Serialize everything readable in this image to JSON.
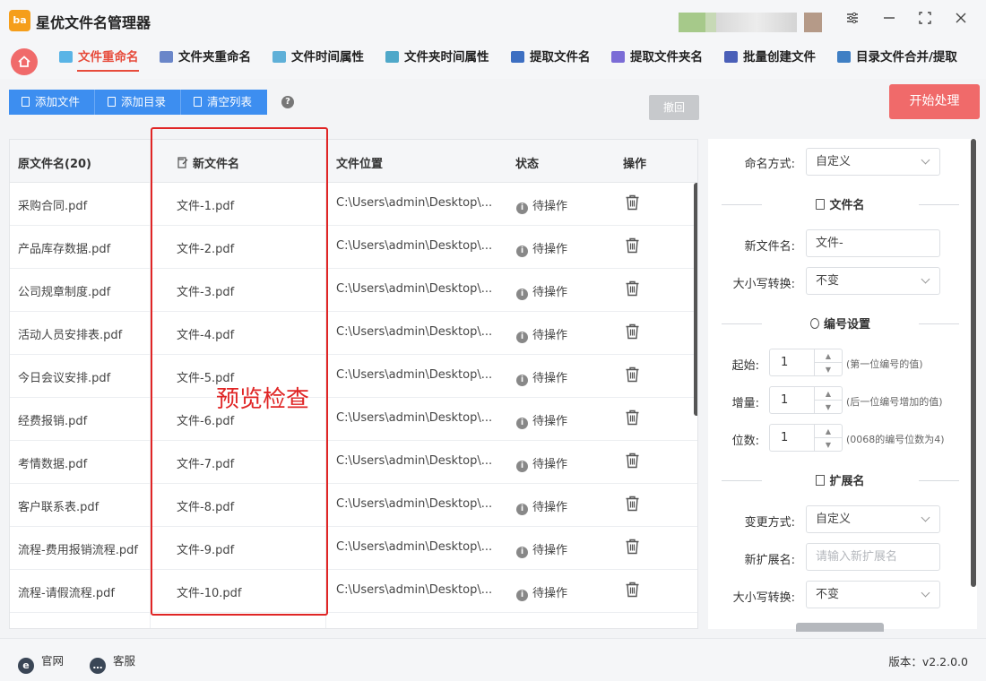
{
  "app": {
    "title": "星优文件名管理器",
    "logo_text": "ba"
  },
  "nav": {
    "tabs": [
      {
        "label": "文件重命名",
        "active": true
      },
      {
        "label": "文件夹重命名",
        "active": false
      },
      {
        "label": "文件时间属性",
        "active": false
      },
      {
        "label": "文件夹时间属性",
        "active": false
      },
      {
        "label": "提取文件名",
        "active": false
      },
      {
        "label": "提取文件夹名",
        "active": false
      },
      {
        "label": "批量创建文件",
        "active": false
      },
      {
        "label": "目录文件合并/提取",
        "active": false
      }
    ]
  },
  "toolbar": {
    "add_file": "添加文件",
    "add_dir": "添加目录",
    "clear_list": "清空列表",
    "help": "?",
    "undo": "撤回",
    "start": "开始处理"
  },
  "table": {
    "headers": {
      "original": "原文件名(20)",
      "new_name": "新文件名",
      "location": "文件位置",
      "status": "状态",
      "action": "操作"
    },
    "rows": [
      {
        "original": "采购合同.pdf",
        "new_name": "文件-1.pdf",
        "location": "C:\\Users\\admin\\Desktop\\...",
        "status": "待操作"
      },
      {
        "original": "产品库存数据.pdf",
        "new_name": "文件-2.pdf",
        "location": "C:\\Users\\admin\\Desktop\\...",
        "status": "待操作"
      },
      {
        "original": "公司规章制度.pdf",
        "new_name": "文件-3.pdf",
        "location": "C:\\Users\\admin\\Desktop\\...",
        "status": "待操作"
      },
      {
        "original": "活动人员安排表.pdf",
        "new_name": "文件-4.pdf",
        "location": "C:\\Users\\admin\\Desktop\\...",
        "status": "待操作"
      },
      {
        "original": "今日会议安排.pdf",
        "new_name": "文件-5.pdf",
        "location": "C:\\Users\\admin\\Desktop\\...",
        "status": "待操作"
      },
      {
        "original": "经费报销.pdf",
        "new_name": "文件-6.pdf",
        "location": "C:\\Users\\admin\\Desktop\\...",
        "status": "待操作"
      },
      {
        "original": "考情数据.pdf",
        "new_name": "文件-7.pdf",
        "location": "C:\\Users\\admin\\Desktop\\...",
        "status": "待操作"
      },
      {
        "original": "客户联系表.pdf",
        "new_name": "文件-8.pdf",
        "location": "C:\\Users\\admin\\Desktop\\...",
        "status": "待操作"
      },
      {
        "original": "流程-费用报销流程.pdf",
        "new_name": "文件-9.pdf",
        "location": "C:\\Users\\admin\\Desktop\\...",
        "status": "待操作"
      },
      {
        "original": "流程-请假流程.pdf",
        "new_name": "文件-10.pdf",
        "location": "C:\\Users\\admin\\Desktop\\...",
        "status": "待操作"
      }
    ]
  },
  "annotation": {
    "label": "预览检查",
    "color": "#e02525"
  },
  "panel": {
    "naming_mode_label": "命名方式:",
    "naming_mode_value": "自定义",
    "filename_section": "文件名",
    "new_name_label": "新文件名:",
    "new_name_value": "文件-",
    "case_label": "大小写转换:",
    "case_value": "不变",
    "numbering_section": "编号设置",
    "start_label": "起始:",
    "start_value": "1",
    "start_hint": "(第一位编号的值)",
    "step_label": "增量:",
    "step_value": "1",
    "step_hint": "(后一位编号增加的值)",
    "digits_label": "位数:",
    "digits_value": "1",
    "digits_hint": "(0068的编号位数为4)",
    "ext_section": "扩展名",
    "ext_mode_label": "变更方式:",
    "ext_mode_value": "自定义",
    "new_ext_label": "新扩展名:",
    "new_ext_placeholder": "请输入新扩展名",
    "ext_case_label": "大小写转换:",
    "ext_case_value": "不变"
  },
  "footer": {
    "website": "官网",
    "support": "客服",
    "version": "版本：v2.2.0.0"
  },
  "colors": {
    "accent_red": "#f06a6a",
    "primary_blue": "#3d8ef0",
    "frame_red": "#e02525"
  }
}
